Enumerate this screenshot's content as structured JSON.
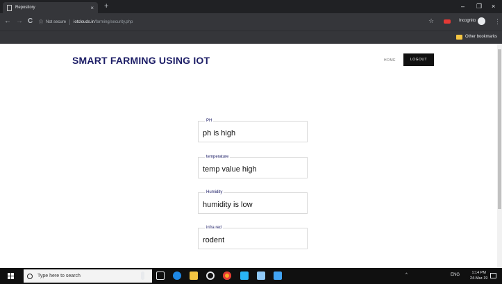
{
  "browser": {
    "tab_title": "Repository",
    "tab_close": "×",
    "new_tab": "+",
    "window_controls": {
      "minimize": "–",
      "maximize": "❐",
      "close": "×"
    },
    "nav": {
      "back": "←",
      "forward": "→",
      "reload": "C"
    },
    "address": {
      "security_icon": "ⓘ",
      "security_text": "Not secure",
      "host": "iotclouds.in",
      "path": "/farming/security.php"
    },
    "star": "☆",
    "incognito_label": "Incognito",
    "menu": "⋮",
    "bookmarks_other": "Other bookmarks",
    "icons": [
      "page-icon",
      "star-icon",
      "extension-icon",
      "incognito-icon",
      "menu-icon",
      "folder-icon"
    ]
  },
  "page": {
    "site_title": "SMART FARMING USING IOT",
    "nav_home": "HOME",
    "nav_logout": "LOGOUT",
    "fields": [
      {
        "label": "PH",
        "value": "ph is high"
      },
      {
        "label": "temperature",
        "value": "temp value high"
      },
      {
        "label": "Humidity",
        "value": "humidity is low"
      },
      {
        "label": "infra red",
        "value": "rodent"
      }
    ],
    "colors": {
      "title": "#1c1d66",
      "logout_bg": "#111111"
    }
  },
  "taskbar": {
    "search_placeholder": "Type here to search",
    "tray": {
      "chevron": "^",
      "language": "ENG"
    },
    "clock": {
      "time": "1:14 PM",
      "date": "24-Mar-19"
    },
    "icons": [
      "windows-icon",
      "microphone-icon",
      "task-view-icon",
      "edge-icon",
      "file-explorer-icon",
      "media-icon",
      "chrome-icon",
      "app-icon",
      "notes-icon",
      "store-icon",
      "notification-icon"
    ]
  }
}
